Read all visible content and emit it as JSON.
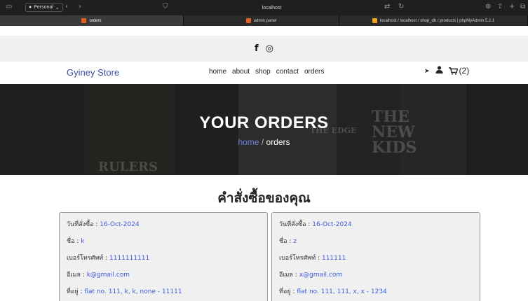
{
  "browser": {
    "profile_label": "Personal",
    "url": "localhost",
    "tabs": [
      {
        "label": "orders",
        "active": true
      },
      {
        "label": "admin panel",
        "active": false
      },
      {
        "label": "localhost / localhost / shop_db / products | phpMyAdmin 5.2.1",
        "active": false
      }
    ]
  },
  "social": {
    "facebook_icon": "f",
    "instagram_icon": "◎"
  },
  "header": {
    "logo": "Gyiney Store",
    "nav": [
      "home",
      "about",
      "shop",
      "contact",
      "orders"
    ],
    "cart_count": "(2)"
  },
  "hero": {
    "title": "YOUR ORDERS",
    "crumb_home": "home",
    "crumb_sep": " / ",
    "crumb_current": "orders",
    "book_texts": [
      "RULERS",
      "THE EDGE",
      "THE NEW KIDS"
    ]
  },
  "section_title": "คำสั่งซื้อของคุณ",
  "orders": [
    {
      "date_label": "วันที่สั่งซื้อ : ",
      "date": "16-Oct-2024",
      "name_label": "ชื่อ : ",
      "name": "k",
      "phone_label": "เบอร์โทรศัพท์ : ",
      "phone": "1111111111",
      "email_label": "อีเมล : ",
      "email": "k@gmail.com",
      "address_label": "ที่อยู่ : ",
      "address": "flat no. 111, k, k, none - 11111"
    },
    {
      "date_label": "วันที่สั่งซื้อ : ",
      "date": "16-Oct-2024",
      "name_label": "ชื่อ : ",
      "name": "z",
      "phone_label": "เบอร์โทรศัพท์ : ",
      "phone": "111111",
      "email_label": "อีเมล : ",
      "email": "x@gmail.com",
      "address_label": "ที่อยู่ : ",
      "address": "flat no. 111, 111, x, x - 1234"
    }
  ]
}
